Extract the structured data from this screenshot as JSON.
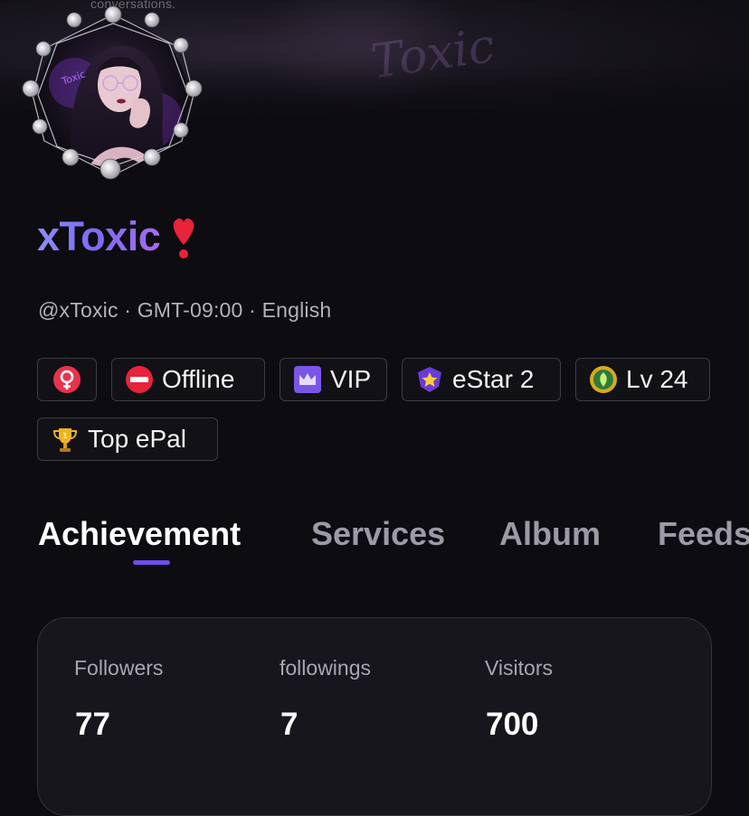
{
  "banner": {
    "caption": "conversations.",
    "watermark": "Toxic"
  },
  "profile": {
    "name": "xToxic",
    "name_emoji_icon": "heavy-exclamation-heart-icon",
    "subtitle": "@xToxic · GMT-09:00 · English"
  },
  "badges": [
    {
      "name": "gender-female",
      "icon": "female-symbol-icon",
      "label": ""
    },
    {
      "name": "status",
      "icon": "no-entry-icon",
      "label": "Offline"
    },
    {
      "name": "vip",
      "icon": "crown-icon",
      "label": "VIP"
    },
    {
      "name": "estar",
      "icon": "star-shield-icon",
      "label": "eStar 2"
    },
    {
      "name": "level",
      "icon": "leaf-medal-icon",
      "label": "Lv 24"
    },
    {
      "name": "top-epal",
      "icon": "trophy-icon",
      "label": "Top ePal"
    }
  ],
  "tabs": [
    {
      "label": "Achievement",
      "active": true
    },
    {
      "label": "Services",
      "active": false
    },
    {
      "label": "Album",
      "active": false
    },
    {
      "label": "Feeds",
      "active": false
    }
  ],
  "stats": [
    {
      "label": "Followers",
      "value": "77"
    },
    {
      "label": "followings",
      "value": "7"
    },
    {
      "label": "Visitors",
      "value": "700"
    }
  ],
  "colors": {
    "background": "#0d0c10",
    "accent": "#6f4ef0",
    "name_gradient_start": "#8f8cf9",
    "name_gradient_end": "#a86af0",
    "badge_border": "#3e3c44",
    "tab_inactive": "#9d9aa6"
  }
}
